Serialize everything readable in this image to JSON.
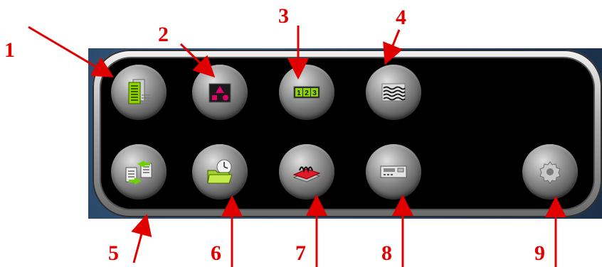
{
  "callouts": [
    "1",
    "2",
    "3",
    "4",
    "5",
    "6",
    "7",
    "8",
    "9"
  ],
  "buttons": [
    {
      "id": "b1",
      "icon": "document-list-icon"
    },
    {
      "id": "b2",
      "icon": "shapes-icon"
    },
    {
      "id": "b3",
      "icon": "number-sequence-icon"
    },
    {
      "id": "b4",
      "icon": "waveform-icon"
    },
    {
      "id": "b5",
      "icon": "document-transfer-icon"
    },
    {
      "id": "b6",
      "icon": "folder-clock-icon"
    },
    {
      "id": "b7",
      "icon": "spring-plate-icon"
    },
    {
      "id": "b8",
      "icon": "device-panel-icon"
    },
    {
      "id": "b9",
      "icon": "gear-icon"
    }
  ],
  "icon_text": {
    "numbers": [
      "1",
      "2",
      "3"
    ]
  },
  "colors": {
    "callout": "#e00000",
    "panel": "#000000",
    "frame_bg": "#2c4a6b",
    "icon_green": "#8fd400",
    "icon_magenta": "#e0006a"
  }
}
